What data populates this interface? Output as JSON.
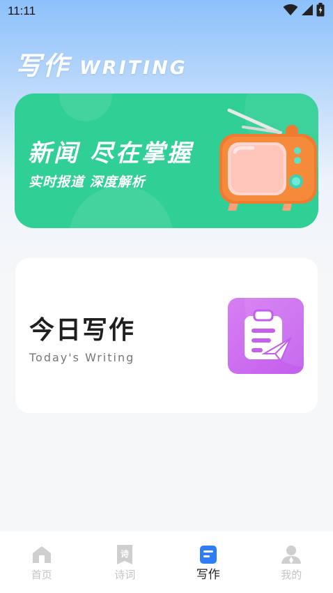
{
  "status_bar": {
    "time": "11:11",
    "icons": [
      "wifi-icon",
      "signal-icon",
      "battery-icon"
    ]
  },
  "header": {
    "title": "写作",
    "subtitle": "WRITING"
  },
  "news_banner": {
    "title": "新闻 尽在掌握",
    "subtitle": "实时报道 深度解析",
    "background": "#2fcf95",
    "illustration": "retro-tv-icon"
  },
  "writing_card": {
    "title": "今日写作",
    "subtitle": "Today's Writing",
    "icon": "clipboard-send-icon",
    "icon_color": "#cd6ef0"
  },
  "tab_bar": {
    "active_index": 2,
    "active_color": "#2f7df6",
    "tabs": [
      {
        "label": "首页",
        "icon": "home-icon"
      },
      {
        "label": "诗词",
        "icon": "poetry-book-icon"
      },
      {
        "label": "写作",
        "icon": "document-icon"
      },
      {
        "label": "我的",
        "icon": "profile-icon"
      }
    ]
  }
}
